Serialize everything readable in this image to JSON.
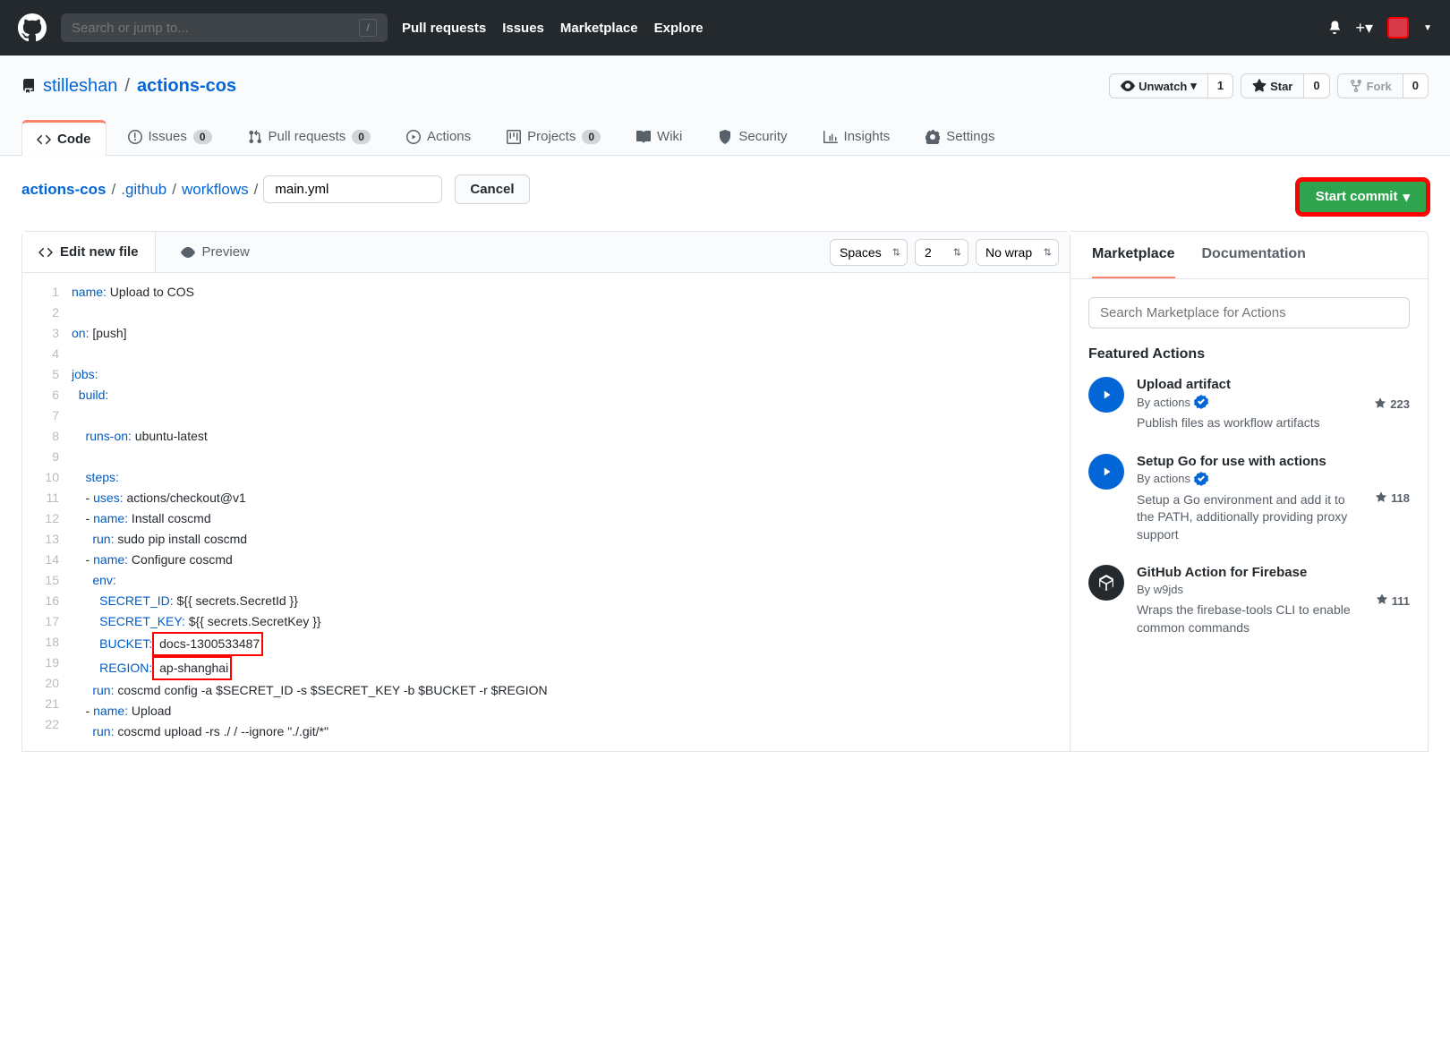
{
  "header": {
    "search_placeholder": "Search or jump to...",
    "nav": [
      "Pull requests",
      "Issues",
      "Marketplace",
      "Explore"
    ]
  },
  "repo": {
    "owner": "stilleshan",
    "name": "actions-cos",
    "unwatch": "Unwatch",
    "unwatch_count": "1",
    "star": "Star",
    "star_count": "0",
    "fork": "Fork",
    "fork_count": "0"
  },
  "tabs": {
    "code": "Code",
    "issues": "Issues",
    "issues_count": "0",
    "pulls": "Pull requests",
    "pulls_count": "0",
    "actions": "Actions",
    "projects": "Projects",
    "projects_count": "0",
    "wiki": "Wiki",
    "security": "Security",
    "insights": "Insights",
    "settings": "Settings"
  },
  "breadcrumb": {
    "root": "actions-cos",
    "dir1": ".github",
    "dir2": "workflows",
    "filename": "main.yml",
    "cancel": "Cancel",
    "commit": "Start commit"
  },
  "editor": {
    "tab_edit": "Edit new file",
    "tab_preview": "Preview",
    "indent": "Spaces",
    "indent_size": "2",
    "wrap": "No wrap"
  },
  "code": {
    "lines": [
      "1",
      "2",
      "3",
      "4",
      "5",
      "6",
      "7",
      "8",
      "9",
      "10",
      "11",
      "12",
      "13",
      "14",
      "15",
      "16",
      "17",
      "18",
      "19",
      "20",
      "21",
      "22"
    ],
    "l1_k": "name:",
    "l1_v": " Upload to COS",
    "l3_k": "on:",
    "l3_v": " [push]",
    "l5_k": "jobs:",
    "l6_k": "  build:",
    "l8_k": "    runs-on:",
    "l8_v": " ubuntu-latest",
    "l10_k": "    steps:",
    "l11_p": "    - ",
    "l11_k": "uses:",
    "l11_v": " actions/checkout@v1",
    "l12_p": "    - ",
    "l12_k": "name:",
    "l12_v": " Install coscmd",
    "l13_p": "      ",
    "l13_k": "run:",
    "l13_v": " sudo pip install coscmd",
    "l14_p": "    - ",
    "l14_k": "name:",
    "l14_v": " Configure coscmd",
    "l15_p": "      ",
    "l15_k": "env:",
    "l16_p": "        ",
    "l16_k": "SECRET_ID:",
    "l16_v": " ${{ secrets.SecretId }}",
    "l17_p": "        ",
    "l17_k": "SECRET_KEY:",
    "l17_v": " ${{ secrets.SecretKey }}",
    "l18_p": "        ",
    "l18_k": "BUCKET:",
    "l18_v": " docs-1300533487",
    "l19_p": "        ",
    "l19_k": "REGION:",
    "l19_v": " ap-shanghai",
    "l20_p": "      ",
    "l20_k": "run:",
    "l20_v": " coscmd config -a $SECRET_ID -s $SECRET_KEY -b $BUCKET -r $REGION",
    "l21_p": "    - ",
    "l21_k": "name:",
    "l21_v": " Upload",
    "l22_p": "      ",
    "l22_k": "run:",
    "l22_v": " coscmd upload -rs ./ / --ignore \"./.git/*\""
  },
  "sidebar": {
    "tab_market": "Marketplace",
    "tab_docs": "Documentation",
    "search_placeholder": "Search Marketplace for Actions",
    "featured": "Featured Actions",
    "actions": [
      {
        "title": "Upload artifact",
        "by": "By actions",
        "desc": "Publish files as workflow artifacts",
        "stars": "223",
        "verified": true
      },
      {
        "title": "Setup Go for use with actions",
        "by": "By actions",
        "desc": "Setup a Go environment and add it to the PATH, additionally providing proxy support",
        "stars": "118",
        "verified": true
      },
      {
        "title": "GitHub Action for Firebase",
        "by": "By w9jds",
        "desc": "Wraps the firebase-tools CLI to enable common commands",
        "stars": "111",
        "verified": false
      }
    ]
  }
}
